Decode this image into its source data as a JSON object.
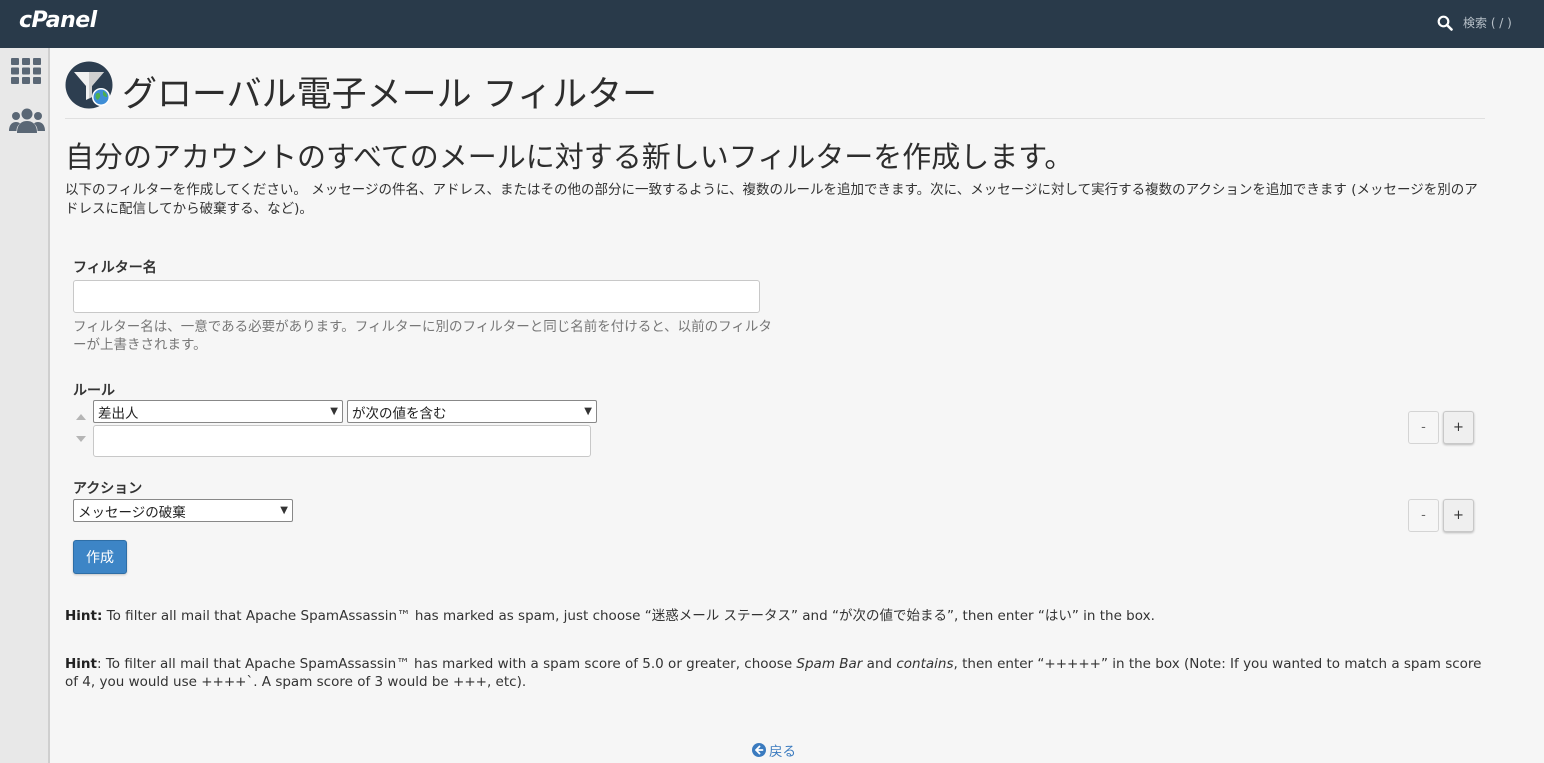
{
  "topbar": {
    "logo": "cPanel",
    "search_label": "検索 ( / )"
  },
  "sidebar": {
    "icons": [
      "apps-grid-icon",
      "users-icon"
    ]
  },
  "page": {
    "title": "グローバル電子メール フィルター",
    "subheading": "自分のアカウントのすべてのメールに対する新しいフィルターを作成します。",
    "description": "以下のフィルターを作成してください。 メッセージの件名、アドレス、またはその他の部分に一致するように、複数のルールを追加できます。次に、メッセージに対して実行する複数のアクションを追加できます (メッセージを別のアドレスに配信してから破棄する、など)。"
  },
  "form": {
    "filter_name_label": "フィルター名",
    "filter_name_value": "",
    "filter_name_help": "フィルター名は、一意である必要があります。フィルターに別のフィルターと同じ名前を付けると、以前のフィルターが上書きされます。",
    "rules_label": "ルール",
    "rule_field_selected": "差出人",
    "rule_operator_selected": "が次の値を含む",
    "rule_value": "",
    "actions_label": "アクション",
    "action_selected": "メッセージの破棄",
    "minus_label": "-",
    "plus_label": "+",
    "create_button": "作成"
  },
  "hints": {
    "hint1_label": "Hint:",
    "hint1_text": " To filter all mail that Apache SpamAssassin™ has marked as spam, just choose “迷惑メール ステータス” and “が次の値で始まる”, then enter “はい” in the box.",
    "hint2_label": "Hint",
    "hint2_part1": ": To filter all mail that Apache SpamAssassin™ has marked with a spam score of 5.0 or greater, choose ",
    "hint2_em1": "Spam Bar",
    "hint2_part2": " and ",
    "hint2_em2": "contains",
    "hint2_part3": ", then enter “+++++” in the box (Note: If you wanted to match a spam score of 4, you would use ++++`. A spam score of 3 would be +++, etc)."
  },
  "footer": {
    "back_label": "戻る"
  },
  "colors": {
    "topbar": "#293a4a",
    "accent": "#3d85c6",
    "link": "#3b7bbf"
  }
}
